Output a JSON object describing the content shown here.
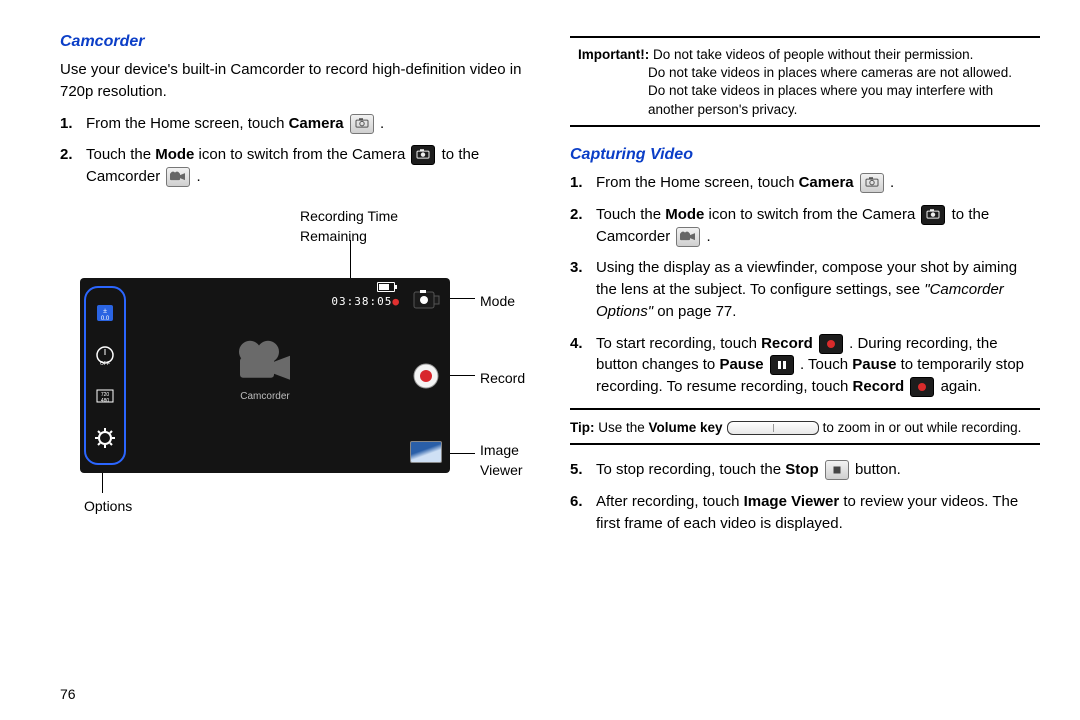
{
  "left": {
    "heading": "Camcorder",
    "intro": "Use your device's built-in Camcorder to record high-definition video in 720p resolution.",
    "step1_a": "From the Home screen, touch ",
    "step1_b": "Camera",
    "step1_c": " .",
    "step2_a": "Touch the ",
    "step2_b": "Mode",
    "step2_c": " icon to switch from the Camera ",
    "step2_d": " to the Camcorder ",
    "step2_e": " .",
    "diag_rectime": "Recording Time\nRemaining",
    "diag_mode": "Mode",
    "diag_record": "Record",
    "diag_image": "Image\nViewer",
    "diag_options": "Options",
    "diag_time": "03:38:05",
    "diag_caption": "Camcorder",
    "page": "76"
  },
  "right": {
    "imp_lbl": "Important!: ",
    "imp_l1": "Do not take videos of people without their permission.",
    "imp_l2": "Do not take videos in places where cameras are not allowed.",
    "imp_l3": "Do not take videos in places where you may interfere with another person's privacy.",
    "heading": "Capturing Video",
    "s1_a": "From the Home screen, touch ",
    "s1_b": "Camera",
    "s1_c": " .",
    "s2_a": "Touch the ",
    "s2_b": "Mode",
    "s2_c": " icon to switch from the Camera ",
    "s2_d": " to the Camcorder ",
    "s2_e": " .",
    "s3_a": "Using the display as a viewfinder, compose your shot by aiming the lens at the subject. To configure settings, see ",
    "s3_b": "\"Camcorder Options\"",
    "s3_c": " on page 77.",
    "s4_a": "To start recording, touch ",
    "s4_b": "Record",
    "s4_c": ". During recording, the button changes to ",
    "s4_d": "Pause",
    "s4_e": ". Touch ",
    "s4_f": "Pause",
    "s4_g": " to temporarily stop recording. To resume recording, touch ",
    "s4_h": "Record",
    "s4_i": " again.",
    "tip_lbl": "Tip: ",
    "tip_a": "Use the ",
    "tip_b": "Volume key",
    "tip_c": " to zoom in or out while recording.",
    "s5_a": "To stop recording, touch the ",
    "s5_b": "Stop",
    "s5_c": " button.",
    "s6_a": "After recording, touch ",
    "s6_b": "Image Viewer",
    "s6_c": " to review your videos. The first frame of each video is displayed."
  }
}
